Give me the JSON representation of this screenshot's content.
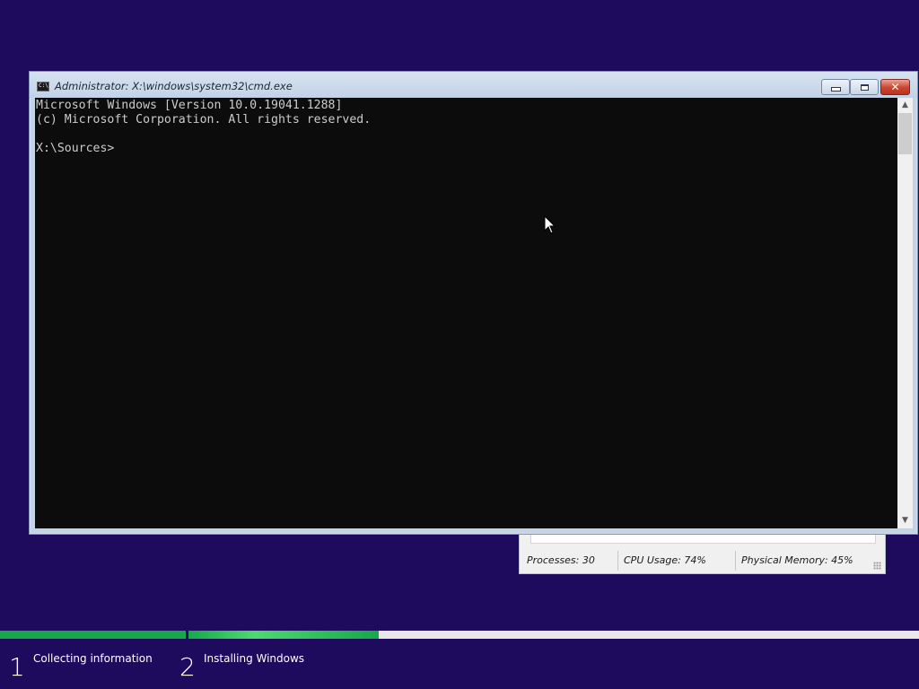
{
  "colors": {
    "desktop_background": "#1e0b5e",
    "console_background": "#0c0c0c",
    "console_text": "#cccccc",
    "progress_green": "#16a84a"
  },
  "cmd_window": {
    "title": "Administrator: X:\\windows\\system32\\cmd.exe",
    "icon": "console-icon",
    "icon_text": "C:\\.",
    "controls": {
      "minimize": "minimize-icon",
      "maximize": "maximize-icon",
      "close_glyph": "✕"
    },
    "console_lines": [
      "Microsoft Windows [Version 10.0.19041.1288]",
      "(c) Microsoft Corporation. All rights reserved.",
      "",
      "X:\\Sources>"
    ],
    "scrollbar": {
      "up_arrow": "▲",
      "down_arrow": "▼"
    }
  },
  "task_manager_status": {
    "processes": "Processes: 30",
    "cpu_usage": "CPU Usage: 74%",
    "physical_memory": "Physical Memory: 45%"
  },
  "setup_progress": {
    "steps": [
      {
        "number": "1",
        "label": "Collecting information",
        "progress": 1.0
      },
      {
        "number": "2",
        "label": "Installing Windows",
        "progress": 0.261
      }
    ]
  }
}
